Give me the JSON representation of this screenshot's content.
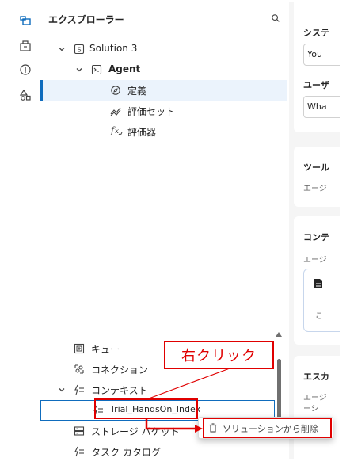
{
  "explorer": {
    "title": "エクスプローラー",
    "tree_top": [
      {
        "label": "Solution 3"
      },
      {
        "label": "Agent"
      },
      {
        "label": "定義"
      },
      {
        "label": "評価セット"
      },
      {
        "label": "評価器"
      }
    ],
    "tree_bottom": [
      {
        "label": "キュー"
      },
      {
        "label": "コネクション"
      },
      {
        "label": "コンテキスト"
      },
      {
        "label": "Trial_HandsOn_Index"
      },
      {
        "label": "ストレージ バケット"
      },
      {
        "label": "タスク カタログ"
      }
    ]
  },
  "editor": {
    "system_label": "システ",
    "system_value": "You",
    "user_label": "ユーザ",
    "user_value": "Wha",
    "tools_label": "ツール",
    "tools_sub": "エージ",
    "context_label": "コンテ",
    "context_sub": "エージ",
    "context_item": "こ",
    "esc_label": "エスカ",
    "esc_sub_1": "エージ",
    "esc_sub_2": "ーシ"
  },
  "context_menu": {
    "item_label": "ソリューションから削除",
    "icon": "trash-icon"
  },
  "annotation": {
    "callout_text": "右クリック",
    "color": "#e00000"
  },
  "colors": {
    "accent": "#0f6cbd",
    "selected_bg": "#ebf3fc"
  }
}
